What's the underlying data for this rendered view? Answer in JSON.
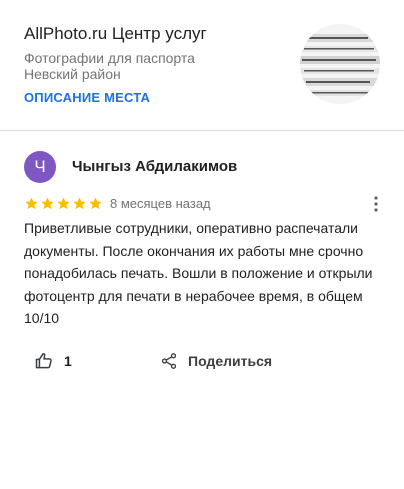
{
  "place": {
    "title": "AllPhoto.ru Центр услуг",
    "category": "Фотографии для паспорта",
    "district": "Невский район",
    "description_link": "ОПИСАНИЕ МЕСТА",
    "photo_icon": "place-photo-thumbnail"
  },
  "review": {
    "avatar_letter": "Ч",
    "avatar_color": "#7e57c2",
    "reviewer_name": "Чынгыз Абдилакимов",
    "rating": 5,
    "rating_max": 5,
    "star_color": "#fbbc04",
    "date": "8 месяцев назад",
    "text": "Приветливые сотрудники, оперативно распечатали документы. После окончания их работы мне срочно понадобилась печать. Вошли в положение и открыли фотоцентр для печати в нерабочее время, в общем 10/10",
    "more_icon": "more-vert-icon"
  },
  "actions": {
    "like_icon": "thumb-up-icon",
    "like_count": "1",
    "share_icon": "share-icon",
    "share_label": "Поделиться"
  },
  "colors": {
    "link": "#1a73e8",
    "secondary_text": "#70757a",
    "divider": "#dadce0"
  }
}
